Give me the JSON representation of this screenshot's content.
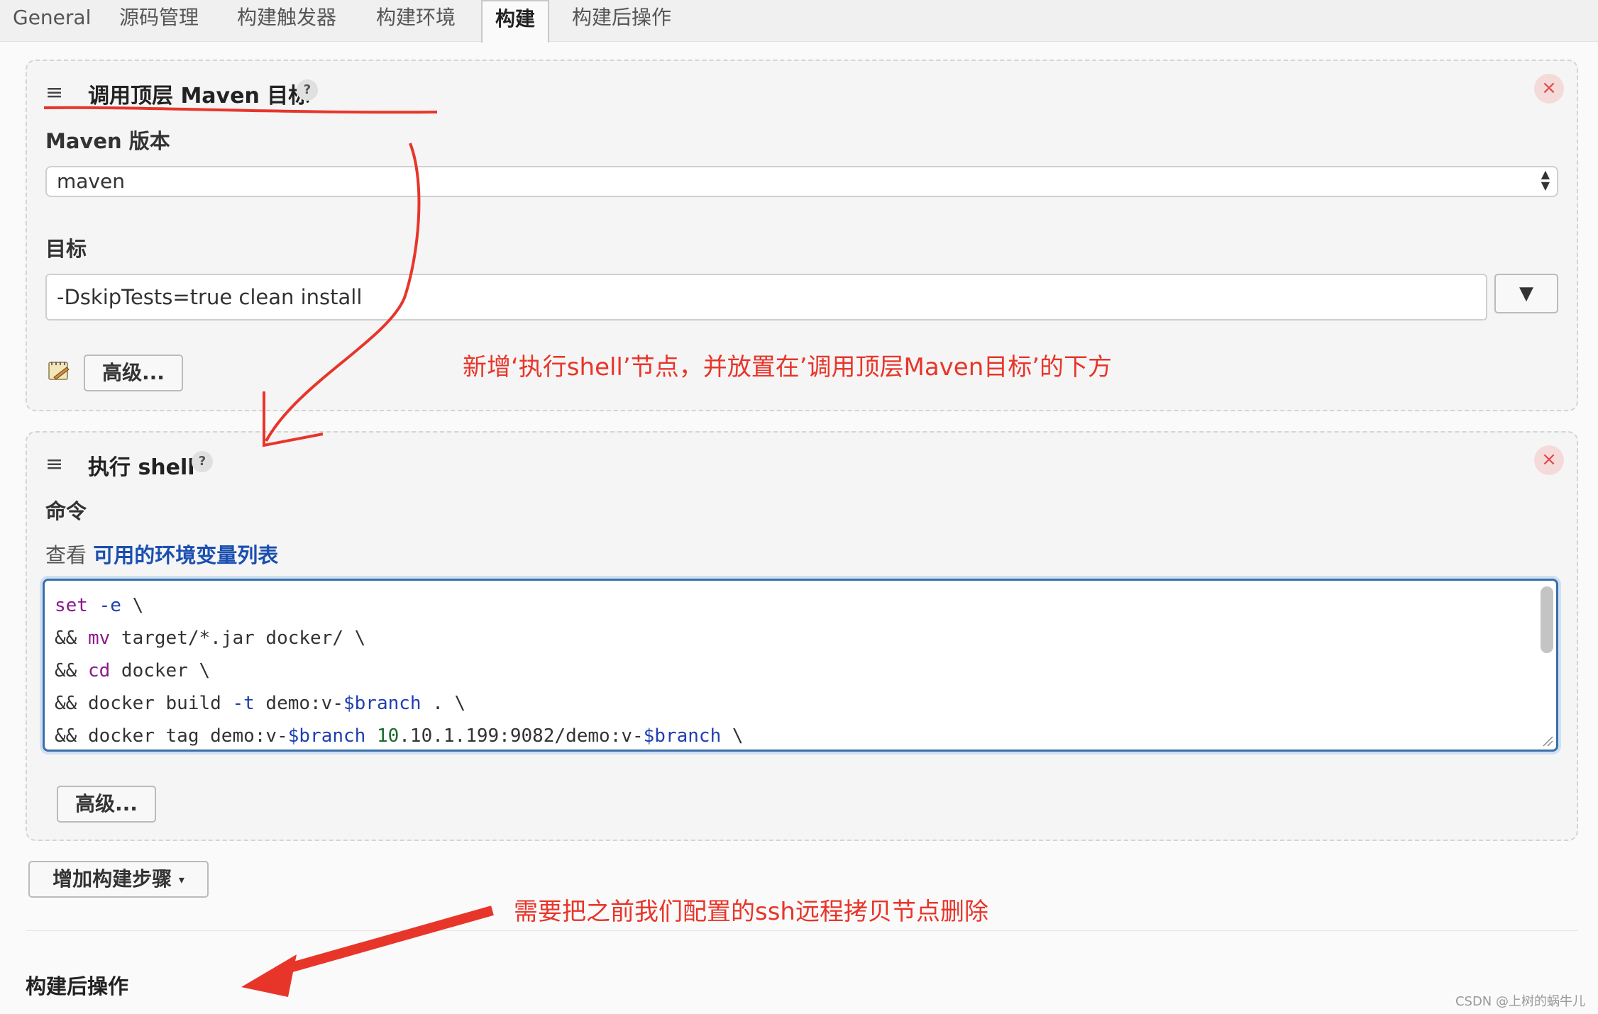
{
  "tabs": [
    {
      "label": "General",
      "active": false
    },
    {
      "label": "源码管理",
      "active": false
    },
    {
      "label": "构建触发器",
      "active": false
    },
    {
      "label": "构建环境",
      "active": false
    },
    {
      "label": "构建",
      "active": true
    },
    {
      "label": "构建后操作",
      "active": false
    }
  ],
  "maven_step": {
    "title": "调用顶层 Maven 目标",
    "help": "?",
    "close": "×",
    "version_label": "Maven 版本",
    "version_value": "maven",
    "goals_label": "目标",
    "goals_value": "-DskipTests=true clean install",
    "goals_expand": "▼",
    "advanced_label": "高级..."
  },
  "shell_step": {
    "title": "执行 shell",
    "help": "?",
    "close": "×",
    "command_label": "命令",
    "env_prefix": "查看",
    "env_link": "可用的环境变量列表",
    "code_lines": [
      "set -e \\",
      "&& mv target/*.jar docker/ \\",
      "&& cd docker \\",
      "&& docker build -t demo:v-$branch . \\",
      "&& docker tag demo:v-$branch 10.10.1.199:9082/demo:v-$branch \\"
    ],
    "advanced_label": "高级..."
  },
  "add_step_button": "增加构建步骤",
  "post_build_heading": "构建后操作",
  "annotations": {
    "note1": "新增‘执行shell’节点，并放置在’调用顶层Maven目标’的下方",
    "note2": "需要把之前我们配置的ssh远程拷贝节点删除"
  },
  "watermark": "CSDN @上树的蜗牛儿",
  "colors": {
    "annotation_red": "#e8352a",
    "link_blue": "#1a4fb0",
    "code_border": "#3b6fa8"
  }
}
